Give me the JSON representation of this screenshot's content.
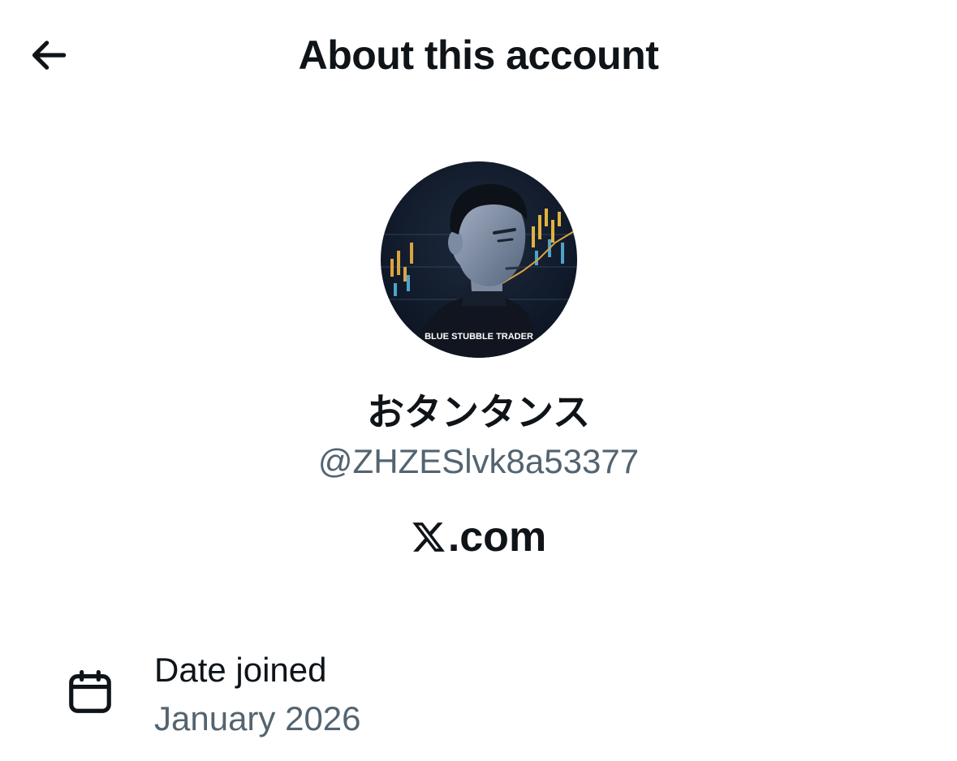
{
  "header": {
    "title": "About this account",
    "back_icon": "arrow-left-icon"
  },
  "profile": {
    "avatar_caption": "BLUE STUBBLE TRADER",
    "display_name": "おタンタンス",
    "handle": "@ZHZESlvk8a53377"
  },
  "platform": {
    "logo_icon": "x-logo-icon",
    "domain_suffix": ".com"
  },
  "details": [
    {
      "icon": "calendar-icon",
      "label": "Date joined",
      "value": "January 2026"
    }
  ],
  "colors": {
    "primary_text": "#0f1419",
    "secondary_text": "#536471",
    "background": "#ffffff"
  }
}
